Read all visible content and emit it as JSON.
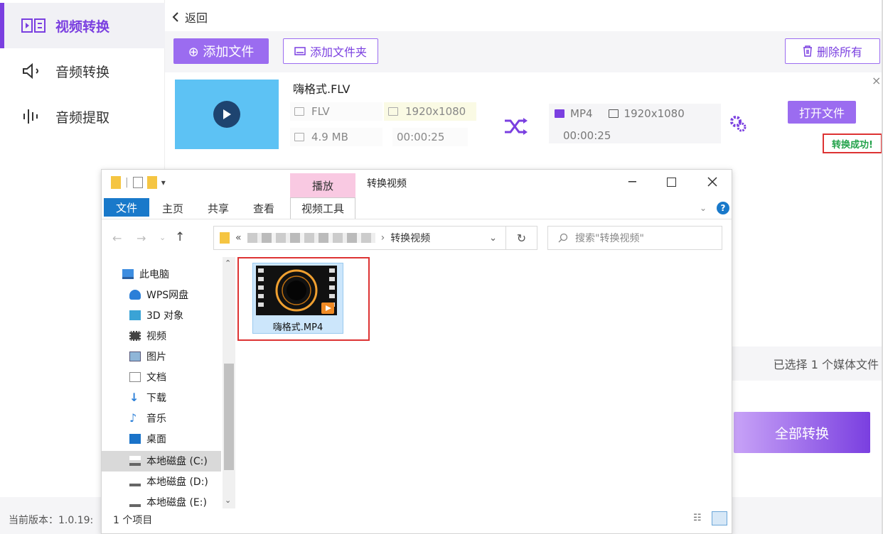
{
  "app": {
    "sidebar": {
      "items": [
        {
          "label": "视频转换",
          "icon": "video-convert-icon",
          "active": true
        },
        {
          "label": "音频转换",
          "icon": "speaker-icon",
          "active": false
        },
        {
          "label": "音频提取",
          "icon": "waveform-icon",
          "active": false
        }
      ]
    },
    "back_label": "返回",
    "toolbar": {
      "add_file": "⊕ 添加文件",
      "add_folder": "添加文件夹",
      "delete_all": "删除所有"
    },
    "file": {
      "name": "嗨格式.FLV",
      "in_format": "FLV",
      "in_resolution": "1920x1080",
      "in_size": "4.9 MB",
      "in_duration": "00:00:25",
      "out_format": "MP4",
      "out_resolution": "1920x1080",
      "out_duration": "00:00:25",
      "open_file": "打开文件",
      "status": "转换成功!",
      "close": "×"
    },
    "selected_info": "已选择 1 个媒体文件",
    "convert_all": "全部转换",
    "version": "当前版本：1.0.19:",
    "colors": {
      "accent": "#7a3fe0",
      "success": "#22a24a",
      "highlight": "#d33333"
    }
  },
  "explorer": {
    "title": "转换视频",
    "context_tab": "播放",
    "tabs": [
      "文件",
      "主页",
      "共享",
      "查看"
    ],
    "video_tools": "视频工具",
    "address_current": "转换视频",
    "address_prefix": "«",
    "search_placeholder": "搜索\"转换视频\"",
    "nav": [
      {
        "label": "此电脑",
        "icon": "computer-icon"
      },
      {
        "label": "WPS网盘",
        "icon": "cloud-icon"
      },
      {
        "label": "3D 对象",
        "icon": "cube-icon"
      },
      {
        "label": "视频",
        "icon": "film-icon"
      },
      {
        "label": "图片",
        "icon": "picture-icon"
      },
      {
        "label": "文档",
        "icon": "document-icon"
      },
      {
        "label": "下载",
        "icon": "download-icon"
      },
      {
        "label": "音乐",
        "icon": "music-icon"
      },
      {
        "label": "桌面",
        "icon": "desktop-icon"
      },
      {
        "label": "本地磁盘 (C:)",
        "icon": "drive-c-icon"
      },
      {
        "label": "本地磁盘 (D:)",
        "icon": "drive-icon"
      },
      {
        "label": "本地磁盘 (E:)",
        "icon": "drive-icon"
      }
    ],
    "files": [
      {
        "name": "嗨格式.MP4"
      }
    ],
    "status_count": "1 个项目"
  }
}
